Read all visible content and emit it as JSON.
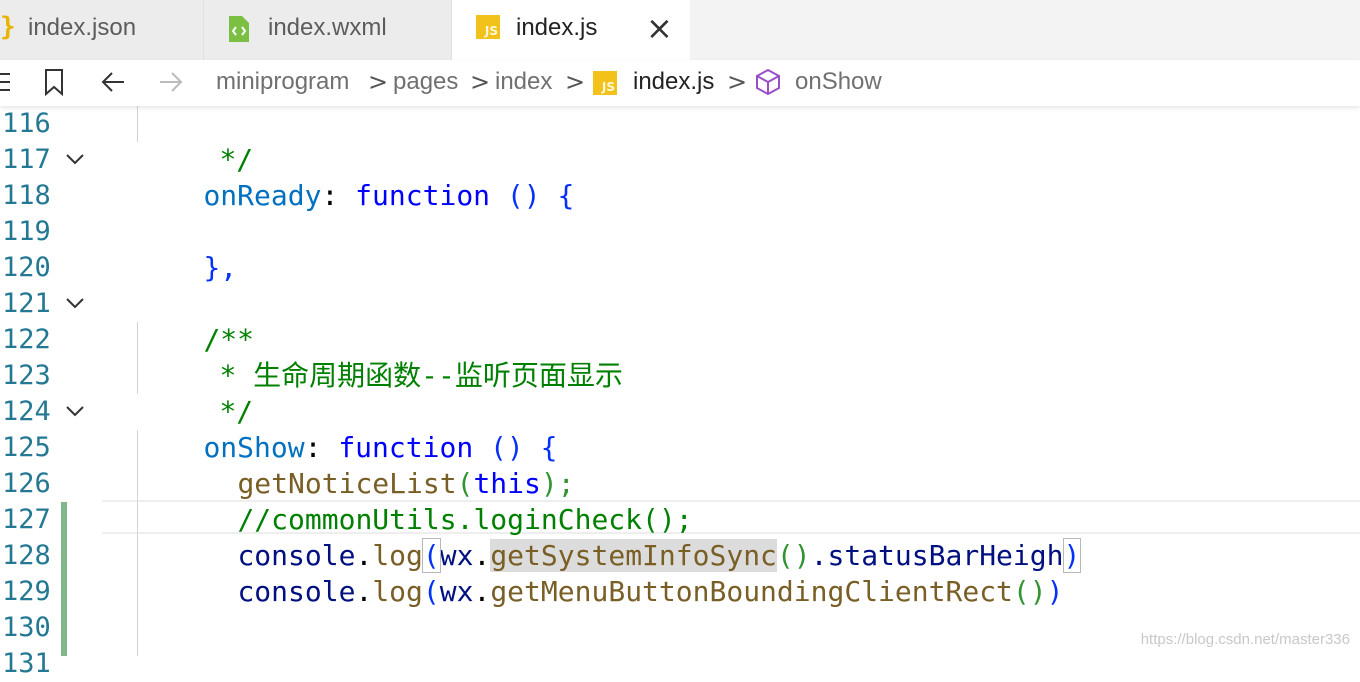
{
  "tabs": [
    {
      "label": "index.json",
      "icon": "json-file-icon"
    },
    {
      "label": "index.wxml",
      "icon": "wxml-file-icon"
    },
    {
      "label": "index.js",
      "icon": "js-file-icon",
      "active": true
    }
  ],
  "tab_close": "×",
  "breadcrumb": {
    "items": [
      "miniprogram",
      "pages",
      "index",
      "index.js",
      "onShow"
    ],
    "separator": ">",
    "js_badge": "JS"
  },
  "line_numbers": [
    "116",
    "117",
    "118",
    "119",
    "120",
    "121",
    "122",
    "123",
    "124",
    "125",
    "126",
    "127",
    "128",
    "129",
    "130",
    "131"
  ],
  "code": {
    "l116": "*/",
    "l117_prop": "onReady",
    "l117_colon": ": ",
    "l117_kw": "function",
    "l117_rest": " () {",
    "l119": "},",
    "l121": "/**",
    "l122": "* 生命周期函数--监听页面显示",
    "l123": "*/",
    "l124_prop": "onShow",
    "l124_colon": ": ",
    "l124_kw": "function",
    "l124_rest": " () {",
    "l125_call": "getNoticeList",
    "l125_open": "(",
    "l125_this": "this",
    "l125_close": ");",
    "l126": "//commonUtils.loginCheck();",
    "l127_obj": "console",
    "l127_dot": ".",
    "l127_fn": "log",
    "l127_open": "(",
    "l127_wx": "wx",
    "l127_dot2": ".",
    "l127_sel": "getSystemInfoSync",
    "l127_parens": "()",
    "l127_prop": ".statusBarHeigh",
    "l127_close": ")",
    "l128_obj": "console",
    "l128_dot": ".",
    "l128_fn": "log",
    "l128_open": "(",
    "l128_wx": "wx",
    "l128_dot2": ".",
    "l128_call": "getMenuButtonBoundingClientRect",
    "l128_parens": "()",
    "l128_close": ")"
  },
  "watermark": "https://blog.csdn.net/master336",
  "colors": {
    "line_number": "#237893",
    "comment": "#008000",
    "keyword": "#0000ff",
    "git_modified": "#81b88b",
    "js_badge": "#f2c21a"
  }
}
